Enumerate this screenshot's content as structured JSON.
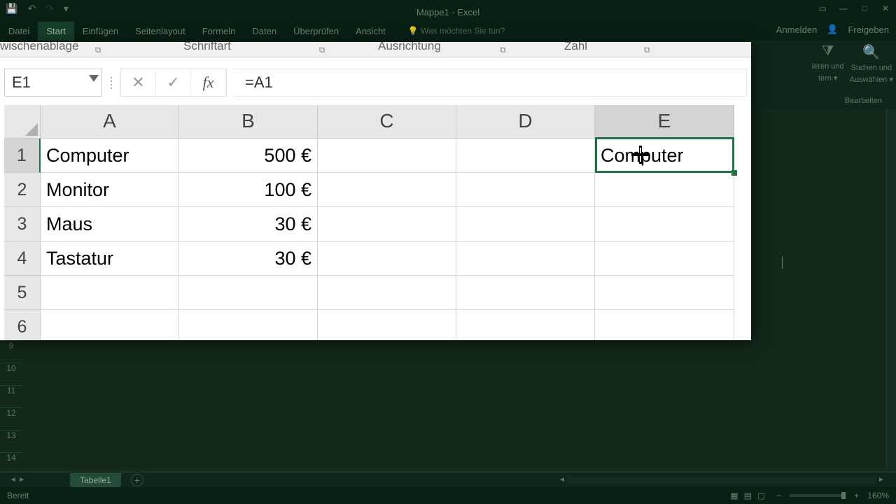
{
  "app": {
    "title": "Mappe1 - Excel",
    "qat": {
      "save": "💾",
      "undo": "↶",
      "redo": "↷",
      "more": "▾"
    },
    "window_controls": {
      "opts": "▭",
      "min": "—",
      "max": "□",
      "close": "✕"
    }
  },
  "ribbon": {
    "tabs": [
      "Datei",
      "Start",
      "Einfügen",
      "Seitenlayout",
      "Formeln",
      "Daten",
      "Überprüfen",
      "Ansicht"
    ],
    "active_tab_index": 1,
    "tell_me": "💡 Was möchten Sie tun?",
    "right": {
      "signin": "Anmelden",
      "share_icon": "👤",
      "share": "Freigeben"
    },
    "groups_partial": {
      "clipboard": "wischenablage",
      "font": "Schriftart",
      "align": "Ausrichtung",
      "number": "Zahl"
    },
    "right_groups": {
      "sortfilter_icon": "⧩",
      "sortfilter1": "ieren und",
      "sortfilter2": "tern ▾",
      "find_icon": "🔍",
      "find1": "Suchen und",
      "find2": "Auswählen ▾",
      "section": "Bearbeiten"
    }
  },
  "formula_bar": {
    "name_box": "E1",
    "cancel": "✕",
    "enter": "✓",
    "fx": "fx",
    "formula": "=A1"
  },
  "grid": {
    "columns": [
      "A",
      "B",
      "C",
      "D",
      "E"
    ],
    "selected_col": "E",
    "selected_row": "1",
    "rows": [
      {
        "n": "1",
        "A": "Computer",
        "B": "500 €",
        "E": "Computer"
      },
      {
        "n": "2",
        "A": "Monitor",
        "B": "100 €",
        "E": ""
      },
      {
        "n": "3",
        "A": "Maus",
        "B": "30 €",
        "E": ""
      },
      {
        "n": "4",
        "A": "Tastatur",
        "B": "30 €",
        "E": ""
      },
      {
        "n": "5",
        "A": "",
        "B": "",
        "E": ""
      },
      {
        "n": "6",
        "A": "",
        "B": "",
        "E": ""
      }
    ],
    "bg_rows": [
      "9",
      "10",
      "11",
      "12",
      "13",
      "14"
    ]
  },
  "sheet_tabs": {
    "active": "Tabelle1",
    "add": "+"
  },
  "statusbar": {
    "status": "Bereit",
    "zoom": "160%",
    "minus": "−",
    "plus": "+"
  }
}
